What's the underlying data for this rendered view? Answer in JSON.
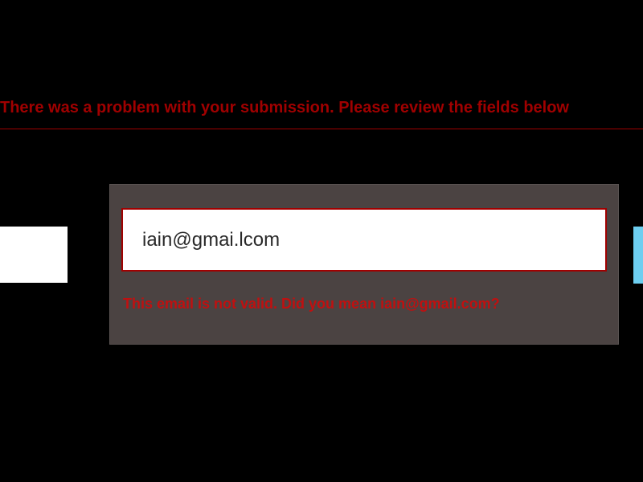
{
  "banner": {
    "message": "There was a problem with your submission. Please review the fields below"
  },
  "form": {
    "email_value": "iain@gmai.lcom",
    "email_error": "This email is not valid. Did you mean iain@gmail.com?"
  }
}
